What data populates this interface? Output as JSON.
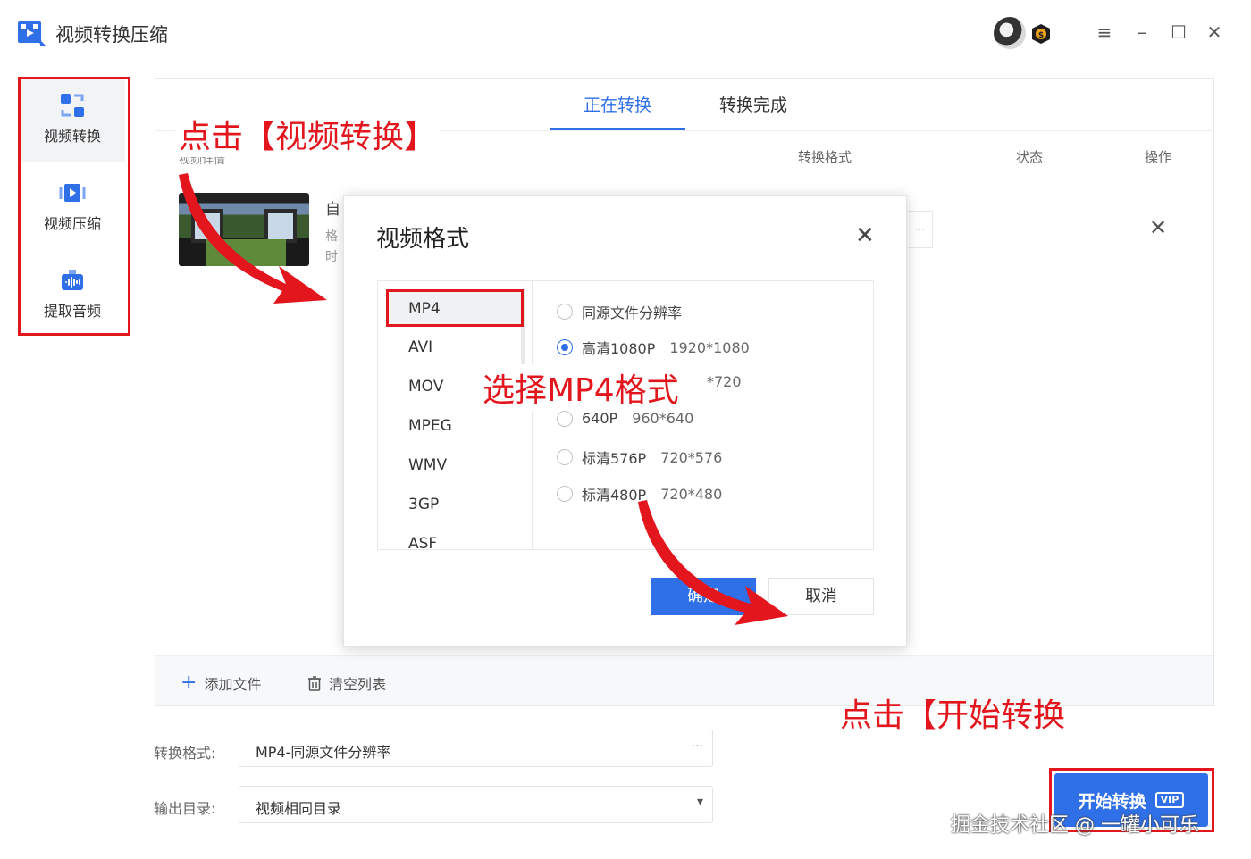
{
  "app": {
    "title": "视频转换压缩"
  },
  "window_controls": {
    "avatar": "avatar",
    "vip_badge": "vip-badge-icon",
    "menu": "≡",
    "minimize": "–",
    "maximize": "☐",
    "close": "✕"
  },
  "sidebar": {
    "items": [
      {
        "label": "视频转换",
        "icon": "video-convert-icon",
        "active": true
      },
      {
        "label": "视频压缩",
        "icon": "video-compress-icon",
        "active": false
      },
      {
        "label": "提取音频",
        "icon": "extract-audio-icon",
        "active": false
      }
    ]
  },
  "tabs": [
    {
      "label": "正在转换",
      "active": true
    },
    {
      "label": "转换完成",
      "active": false
    }
  ],
  "columns": {
    "details": "视频详情",
    "format": "转换格式",
    "status": "状态",
    "action": "操作"
  },
  "file_row": {
    "name_fragment": "自",
    "format_fragment": "格",
    "time_fragment": "时",
    "more": "···",
    "remove": "✕"
  },
  "toolbar": {
    "add_file": "添加文件",
    "clear_list": "清空列表"
  },
  "settings": {
    "format_label": "转换格式:",
    "format_value": "MP4-同源文件分辨率",
    "format_more": "···",
    "output_label": "输出目录:",
    "output_value": "视频相同目录",
    "output_arrow": "▾"
  },
  "start_button": {
    "label": "开始转换",
    "badge": "VIP"
  },
  "dialog": {
    "title": "视频格式",
    "close": "✕",
    "formats": [
      "MP4",
      "AVI",
      "MOV",
      "MPEG",
      "WMV",
      "3GP",
      "ASF"
    ],
    "selected_format": "MP4",
    "resolutions": [
      {
        "label": "同源文件分辨率",
        "size": "",
        "checked": false
      },
      {
        "label": "高清1080P",
        "size": "1920*1080",
        "checked": true
      },
      {
        "label": "",
        "size": "*720",
        "checked": false
      },
      {
        "label": "640P",
        "size": "960*640",
        "checked": false
      },
      {
        "label": "标清576P",
        "size": "720*576",
        "checked": false
      },
      {
        "label": "标清480P",
        "size": "720*480",
        "checked": false
      }
    ],
    "ok": "确定",
    "cancel": "取消"
  },
  "annotations": {
    "click_convert": "点击【视频转换】",
    "choose_mp4": "选择MP4格式",
    "click_start": "点击【开始转换"
  },
  "watermark": "掘金技术社区 @ 一罐小可乐",
  "colors": {
    "accent": "#2f6fe8",
    "annotation_red": "#e3161d"
  }
}
